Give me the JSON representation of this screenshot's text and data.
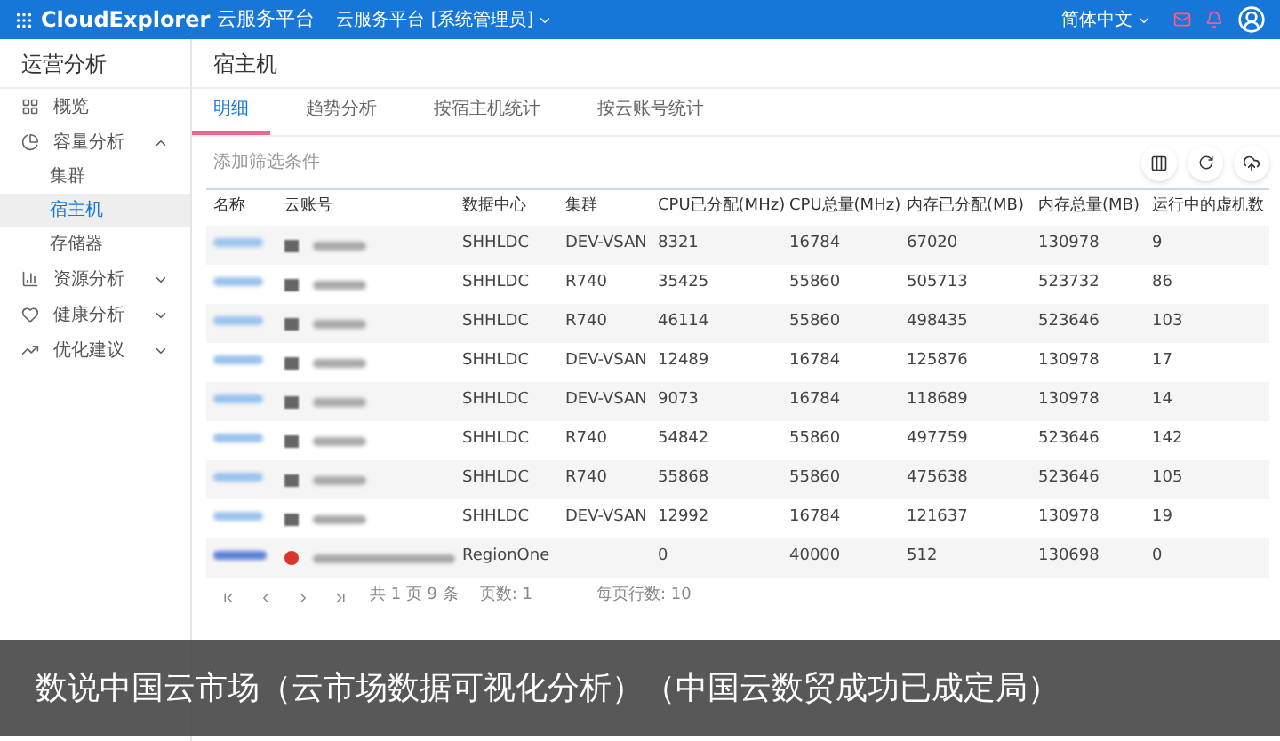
{
  "header": {
    "logo": "CloudExplorer",
    "product": "云服务平台",
    "workspace": "云服务平台 [系统管理员]",
    "language": "简体中文"
  },
  "sidebar": {
    "title": "运营分析",
    "items": [
      {
        "label": "概览"
      },
      {
        "label": "容量分析",
        "expanded": true,
        "children": [
          {
            "label": "集群",
            "selected": false
          },
          {
            "label": "宿主机",
            "selected": true
          },
          {
            "label": "存储器",
            "selected": false
          }
        ]
      },
      {
        "label": "资源分析",
        "expanded": false
      },
      {
        "label": "健康分析",
        "expanded": false
      },
      {
        "label": "优化建议",
        "expanded": false
      }
    ]
  },
  "page_title": "宿主机",
  "tabs": [
    {
      "label": "明细",
      "selected": true
    },
    {
      "label": "趋势分析",
      "selected": false
    },
    {
      "label": "按宿主机统计",
      "selected": false
    },
    {
      "label": "按云账号统计",
      "selected": false
    }
  ],
  "filter": {
    "placeholder": "添加筛选条件"
  },
  "table": {
    "columns": [
      "名称",
      "云账号",
      "数据中心",
      "集群",
      "CPU已分配(MHz)",
      "CPU总量(MHz)",
      "内存已分配(MB)",
      "内存总量(MB)",
      "运行中的虚机数"
    ],
    "rows": [
      {
        "kind": "vmware",
        "cells": [
          "",
          "",
          "SHHLDC",
          "DEV-VSAN",
          "8321",
          "16784",
          "67020",
          "130978",
          "9"
        ]
      },
      {
        "kind": "vmware",
        "cells": [
          "",
          "",
          "SHHLDC",
          "R740",
          "35425",
          "55860",
          "505713",
          "523732",
          "86"
        ]
      },
      {
        "kind": "vmware",
        "cells": [
          "",
          "",
          "SHHLDC",
          "R740",
          "46114",
          "55860",
          "498435",
          "523646",
          "103"
        ]
      },
      {
        "kind": "vmware",
        "cells": [
          "",
          "",
          "SHHLDC",
          "DEV-VSAN",
          "12489",
          "16784",
          "125876",
          "130978",
          "17"
        ]
      },
      {
        "kind": "vmware",
        "cells": [
          "",
          "",
          "SHHLDC",
          "DEV-VSAN",
          "9073",
          "16784",
          "118689",
          "130978",
          "14"
        ]
      },
      {
        "kind": "vmware",
        "cells": [
          "",
          "",
          "SHHLDC",
          "R740",
          "54842",
          "55860",
          "497759",
          "523646",
          "142"
        ]
      },
      {
        "kind": "vmware",
        "cells": [
          "",
          "",
          "SHHLDC",
          "R740",
          "55868",
          "55860",
          "475638",
          "523646",
          "105"
        ]
      },
      {
        "kind": "vmware",
        "cells": [
          "",
          "",
          "SHHLDC",
          "DEV-VSAN",
          "12992",
          "16784",
          "121637",
          "130978",
          "19"
        ]
      },
      {
        "kind": "openstack",
        "cells": [
          "",
          "",
          "RegionOne",
          "",
          "0",
          "40000",
          "512",
          "130698",
          "0"
        ]
      }
    ]
  },
  "pagination": {
    "summary": "共 1 页 9 条",
    "page": "页数: 1",
    "page_size": "每页行数: 10"
  },
  "caption": "数说中国云市场（云市场数据可视化分析）（中国云数贸成功已成定局）"
}
